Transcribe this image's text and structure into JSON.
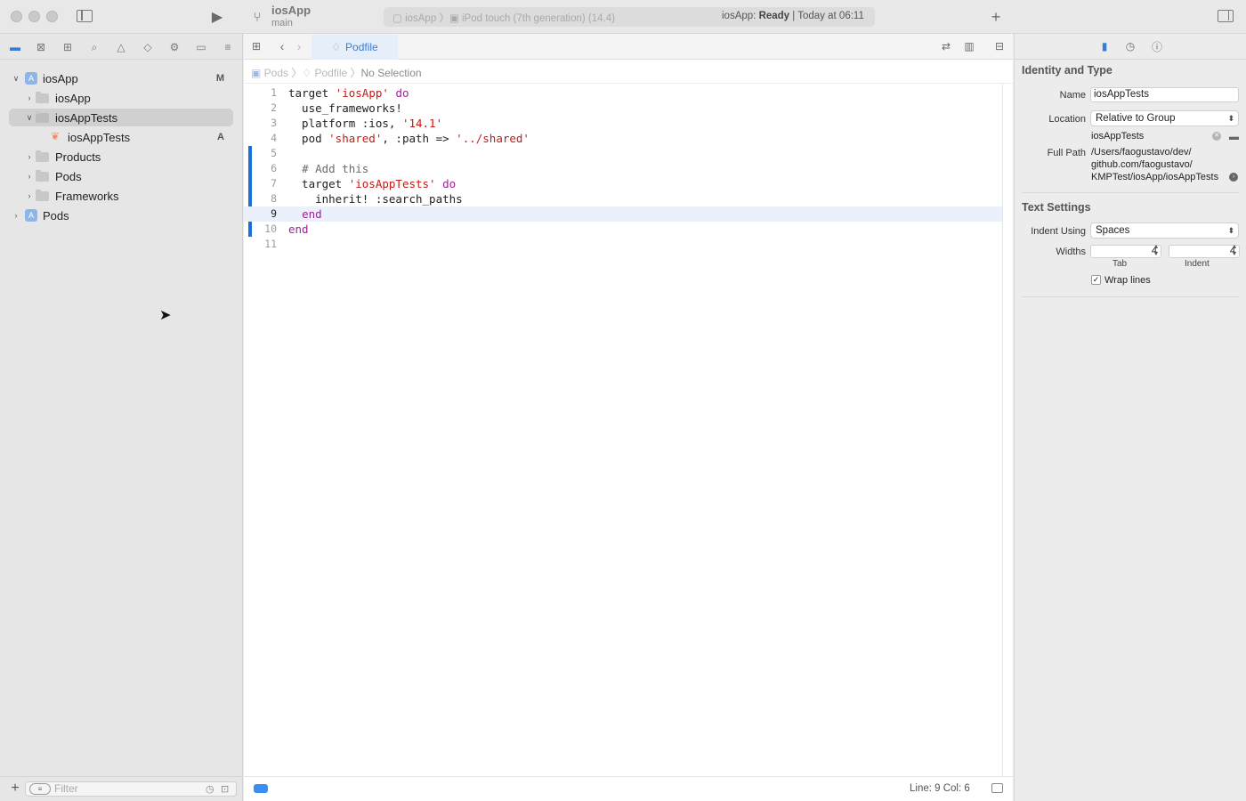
{
  "toolbar": {
    "project_title": "iosApp",
    "branch": "main",
    "scheme": "iosApp",
    "device": "iPod touch (7th generation) (14.4)",
    "status_prefix": "iosApp: ",
    "status_state": "Ready",
    "status_suffix": " | Today at 06:11",
    "run_icon": "play-icon",
    "add_icon": "plus-icon"
  },
  "navigator": {
    "tree": [
      {
        "label": "iosApp",
        "badge": "M"
      },
      {
        "label": "iosApp"
      },
      {
        "label": "iosAppTests"
      },
      {
        "label": "iosAppTests",
        "badge": "A"
      },
      {
        "label": "Products"
      },
      {
        "label": "Pods"
      },
      {
        "label": "Frameworks"
      },
      {
        "label": "Pods"
      }
    ],
    "filter_placeholder": "Filter"
  },
  "editor": {
    "tab": "Podfile",
    "jump": {
      "root": "Pods",
      "file": "Podfile",
      "selection": "No Selection"
    },
    "line_numbers": [
      "1",
      "2",
      "3",
      "4",
      "5",
      "6",
      "7",
      "8",
      "9",
      "10",
      "11"
    ],
    "lines": [
      {
        "a": "target ",
        "b": "'iosApp'",
        "c": " ",
        "d": "do"
      },
      {
        "a": "  use_frameworks!"
      },
      {
        "a": "  platform :ios, ",
        "b": "'14.1'"
      },
      {
        "a": "  pod ",
        "b": "'shared'",
        "c": ", :path => ",
        "d": "'../shared'"
      },
      {
        "a": ""
      },
      {
        "a": "  ",
        "b": "# Add this"
      },
      {
        "a": "  target ",
        "b": "'iosAppTests'",
        "c": " ",
        "d": "do"
      },
      {
        "a": "    inherit! :search_paths"
      },
      {
        "a": "  ",
        "b": "end"
      },
      {
        "a": "end"
      },
      {
        "a": ""
      }
    ],
    "status": "Line: 9  Col: 6"
  },
  "inspector": {
    "identity_title": "Identity and Type",
    "name_label": "Name",
    "name_value": "iosAppTests",
    "location_label": "Location",
    "location_value": "Relative to Group",
    "location_file": "iosAppTests",
    "fullpath_label": "Full Path",
    "fullpath_1": "/Users/faogustavo/dev/",
    "fullpath_2": "github.com/faogustavo/",
    "fullpath_3": "KMPTest/iosApp/iosAppTests",
    "text_title": "Text Settings",
    "indent_label": "Indent Using",
    "indent_value": "Spaces",
    "widths_label": "Widths",
    "tab_value": "4",
    "indent_width_value": "4",
    "tab_caption": "Tab",
    "indent_caption": "Indent",
    "wrap_label": "Wrap lines",
    "wrap_checked": "✓"
  }
}
